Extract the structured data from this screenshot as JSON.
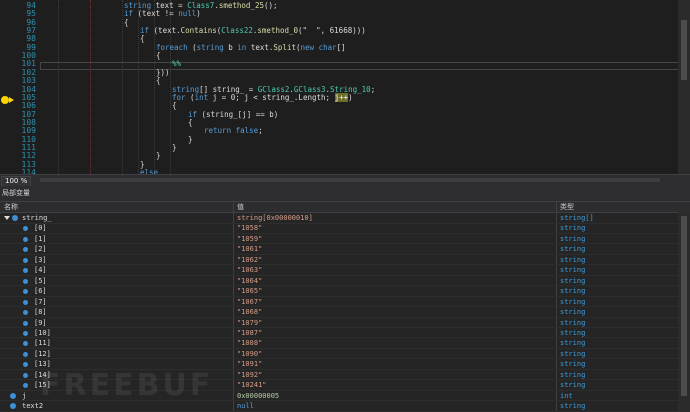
{
  "editor": {
    "current_line": "101",
    "lines": [
      {
        "num": "94",
        "indent": 10,
        "parts": [
          {
            "c": "kw",
            "t": "string"
          },
          {
            "c": "",
            "t": " text = "
          },
          {
            "c": "ty",
            "t": "Class7"
          },
          {
            "c": "",
            "t": "."
          },
          {
            "c": "md",
            "t": "smethod_25"
          },
          {
            "c": "",
            "t": "();"
          }
        ]
      },
      {
        "num": "95",
        "indent": 10,
        "parts": [
          {
            "c": "kw",
            "t": "if"
          },
          {
            "c": "",
            "t": " (text != "
          },
          {
            "c": "kw",
            "t": "null"
          },
          {
            "c": "",
            "t": ")"
          }
        ]
      },
      {
        "num": "96",
        "indent": 10,
        "parts": [
          {
            "c": "",
            "t": "{"
          }
        ]
      },
      {
        "num": "97",
        "indent": 12,
        "parts": [
          {
            "c": "kw",
            "t": "if"
          },
          {
            "c": "",
            "t": " (text."
          },
          {
            "c": "md",
            "t": "Contains"
          },
          {
            "c": "",
            "t": "("
          },
          {
            "c": "ty",
            "t": "Class22"
          },
          {
            "c": "",
            "t": "."
          },
          {
            "c": "md",
            "t": "smethod_0"
          },
          {
            "c": "",
            "t": "(\"  \", 61668)))"
          }
        ]
      },
      {
        "num": "98",
        "indent": 12,
        "parts": [
          {
            "c": "",
            "t": "{"
          }
        ]
      },
      {
        "num": "99",
        "indent": 14,
        "parts": [
          {
            "c": "kw",
            "t": "foreach"
          },
          {
            "c": "",
            "t": " ("
          },
          {
            "c": "kw",
            "t": "string"
          },
          {
            "c": "",
            "t": " b "
          },
          {
            "c": "kw",
            "t": "in"
          },
          {
            "c": "",
            "t": " text."
          },
          {
            "c": "md",
            "t": "Split"
          },
          {
            "c": "",
            "t": "("
          },
          {
            "c": "kw",
            "t": "new"
          },
          {
            "c": "",
            "t": " "
          },
          {
            "c": "kw",
            "t": "char"
          },
          {
            "c": "",
            "t": "[]"
          }
        ]
      },
      {
        "num": "100",
        "indent": 14,
        "parts": [
          {
            "c": "",
            "t": "{"
          }
        ]
      },
      {
        "num": "101",
        "indent": 16,
        "parts": [
          {
            "c": "ty",
            "t": "%%"
          }
        ]
      },
      {
        "num": "102",
        "indent": 14,
        "parts": [
          {
            "c": "",
            "t": "}))"
          }
        ]
      },
      {
        "num": "103",
        "indent": 14,
        "parts": [
          {
            "c": "",
            "t": "{"
          }
        ]
      },
      {
        "num": "104",
        "indent": 16,
        "parts": [
          {
            "c": "kw",
            "t": "string"
          },
          {
            "c": "",
            "t": "[] string_ = "
          },
          {
            "c": "ty",
            "t": "GClass2"
          },
          {
            "c": "",
            "t": "."
          },
          {
            "c": "ty",
            "t": "GClass3"
          },
          {
            "c": "",
            "t": "."
          },
          {
            "c": "ty",
            "t": "String_10"
          },
          {
            "c": "",
            "t": ";"
          }
        ]
      },
      {
        "num": "105",
        "indent": 16,
        "parts": [
          {
            "c": "kw",
            "t": "for"
          },
          {
            "c": "",
            "t": " ("
          },
          {
            "c": "kw",
            "t": "int"
          },
          {
            "c": "",
            "t": " j = 0; j < string_.Length; "
          },
          {
            "c": "hl",
            "t": "j++"
          },
          {
            "c": "",
            "t": ")"
          }
        ]
      },
      {
        "num": "106",
        "indent": 16,
        "parts": [
          {
            "c": "",
            "t": "{"
          }
        ]
      },
      {
        "num": "107",
        "indent": 18,
        "parts": [
          {
            "c": "kw",
            "t": "if"
          },
          {
            "c": "",
            "t": " (string_[j] == b)"
          }
        ]
      },
      {
        "num": "108",
        "indent": 18,
        "parts": [
          {
            "c": "",
            "t": "{"
          }
        ]
      },
      {
        "num": "109",
        "indent": 20,
        "parts": [
          {
            "c": "kw",
            "t": "return"
          },
          {
            "c": "",
            "t": " "
          },
          {
            "c": "kw",
            "t": "false"
          },
          {
            "c": "",
            "t": ";"
          }
        ]
      },
      {
        "num": "110",
        "indent": 18,
        "parts": [
          {
            "c": "",
            "t": "}"
          }
        ]
      },
      {
        "num": "111",
        "indent": 16,
        "parts": [
          {
            "c": "",
            "t": "}"
          }
        ]
      },
      {
        "num": "112",
        "indent": 14,
        "parts": [
          {
            "c": "",
            "t": "}"
          }
        ]
      },
      {
        "num": "113",
        "indent": 12,
        "parts": [
          {
            "c": "",
            "t": "}"
          }
        ]
      },
      {
        "num": "114",
        "indent": 12,
        "parts": [
          {
            "c": "kw",
            "t": "else"
          }
        ]
      }
    ]
  },
  "zoom": "100 %",
  "locals": {
    "title": "局部变量",
    "columns": {
      "name": "名称",
      "value": "值",
      "type": "类型"
    },
    "rows": [
      {
        "name": "string_",
        "value": "string[0x00000010]",
        "type": "string[]",
        "expand": true,
        "kind": "str"
      },
      {
        "name": "[0]",
        "value": "\"1058\"",
        "type": "string",
        "kind": "str"
      },
      {
        "name": "[1]",
        "value": "\"1059\"",
        "type": "string",
        "kind": "str"
      },
      {
        "name": "[2]",
        "value": "\"1061\"",
        "type": "string",
        "kind": "str"
      },
      {
        "name": "[3]",
        "value": "\"1062\"",
        "type": "string",
        "kind": "str"
      },
      {
        "name": "[4]",
        "value": "\"1063\"",
        "type": "string",
        "kind": "str"
      },
      {
        "name": "[5]",
        "value": "\"1064\"",
        "type": "string",
        "kind": "str"
      },
      {
        "name": "[6]",
        "value": "\"1065\"",
        "type": "string",
        "kind": "str"
      },
      {
        "name": "[7]",
        "value": "\"1067\"",
        "type": "string",
        "kind": "str"
      },
      {
        "name": "[8]",
        "value": "\"1068\"",
        "type": "string",
        "kind": "str"
      },
      {
        "name": "[9]",
        "value": "\"1079\"",
        "type": "string",
        "kind": "str"
      },
      {
        "name": "[10]",
        "value": "\"1087\"",
        "type": "string",
        "kind": "str"
      },
      {
        "name": "[11]",
        "value": "\"1088\"",
        "type": "string",
        "kind": "str"
      },
      {
        "name": "[12]",
        "value": "\"1090\"",
        "type": "string",
        "kind": "str"
      },
      {
        "name": "[13]",
        "value": "\"1091\"",
        "type": "string",
        "kind": "str"
      },
      {
        "name": "[14]",
        "value": "\"1092\"",
        "type": "string",
        "kind": "str"
      },
      {
        "name": "[15]",
        "value": "\"10241\"",
        "type": "string",
        "kind": "str"
      },
      {
        "name": "j",
        "value": "0x00000005",
        "type": "int",
        "kind": "num",
        "top": true
      },
      {
        "name": "text2",
        "value": "null",
        "type": "string",
        "kind": "nul",
        "top": true
      }
    ]
  },
  "watermark": "FREEBUF"
}
